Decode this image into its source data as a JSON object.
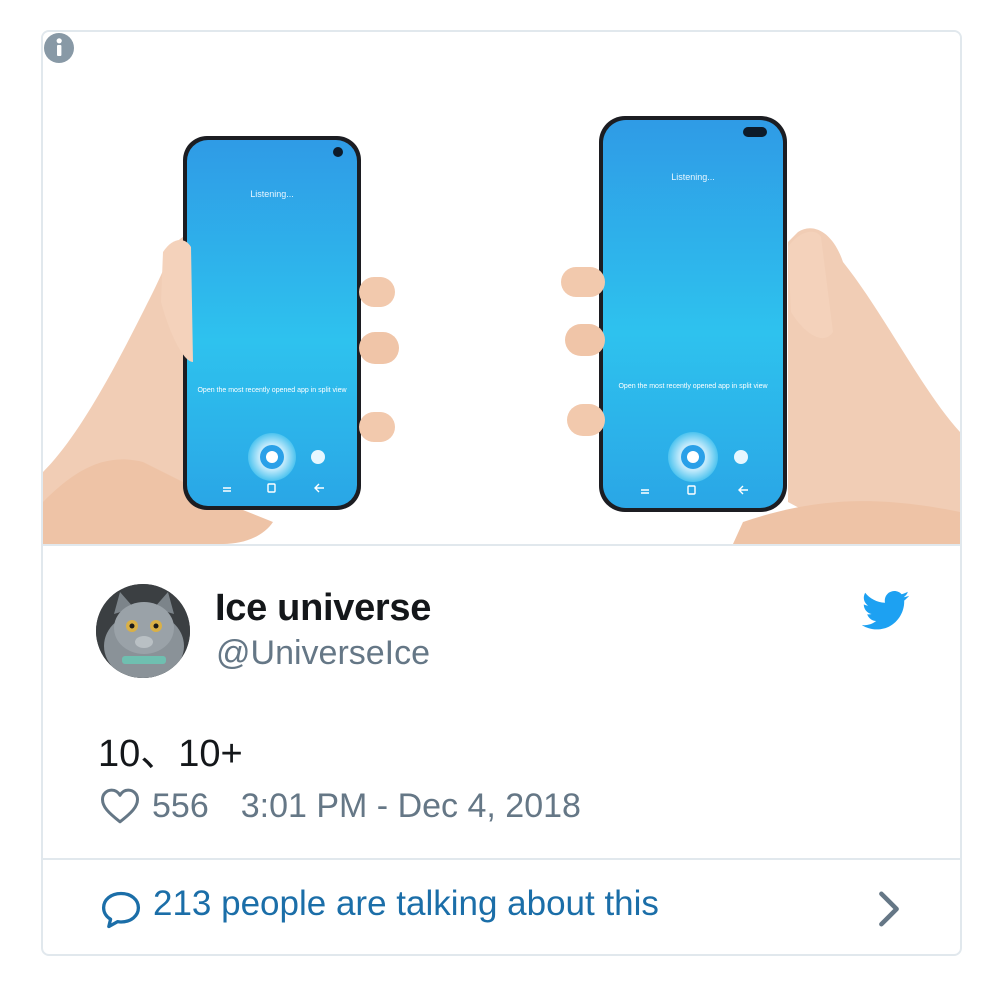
{
  "media": {
    "left_phone": {
      "status": "Listening...",
      "suggestion": "Open the most recently opened app in split view"
    },
    "right_phone": {
      "status": "Listening...",
      "suggestion": "Open the most recently opened app in split view"
    }
  },
  "author": {
    "name": "Ice universe",
    "handle": "@UniverseIce"
  },
  "tweet": {
    "text": "10、10+",
    "likes": "556",
    "timestamp": "3:01 PM - Dec 4, 2018"
  },
  "footer": {
    "link_text": "213 people are talking about this"
  },
  "icons": {
    "info": "info-icon",
    "brand": "twitter-bird-icon",
    "like": "heart-icon",
    "reply": "speech-bubble-icon",
    "more": "chevron-right-icon"
  },
  "colors": {
    "twitter_blue": "#1da1f2",
    "link_blue": "#1b6ea8",
    "muted_gray": "#657786",
    "text_dark": "#14171a",
    "screen_top": "#2f9be6",
    "screen_bottom": "#2dc3e8"
  }
}
